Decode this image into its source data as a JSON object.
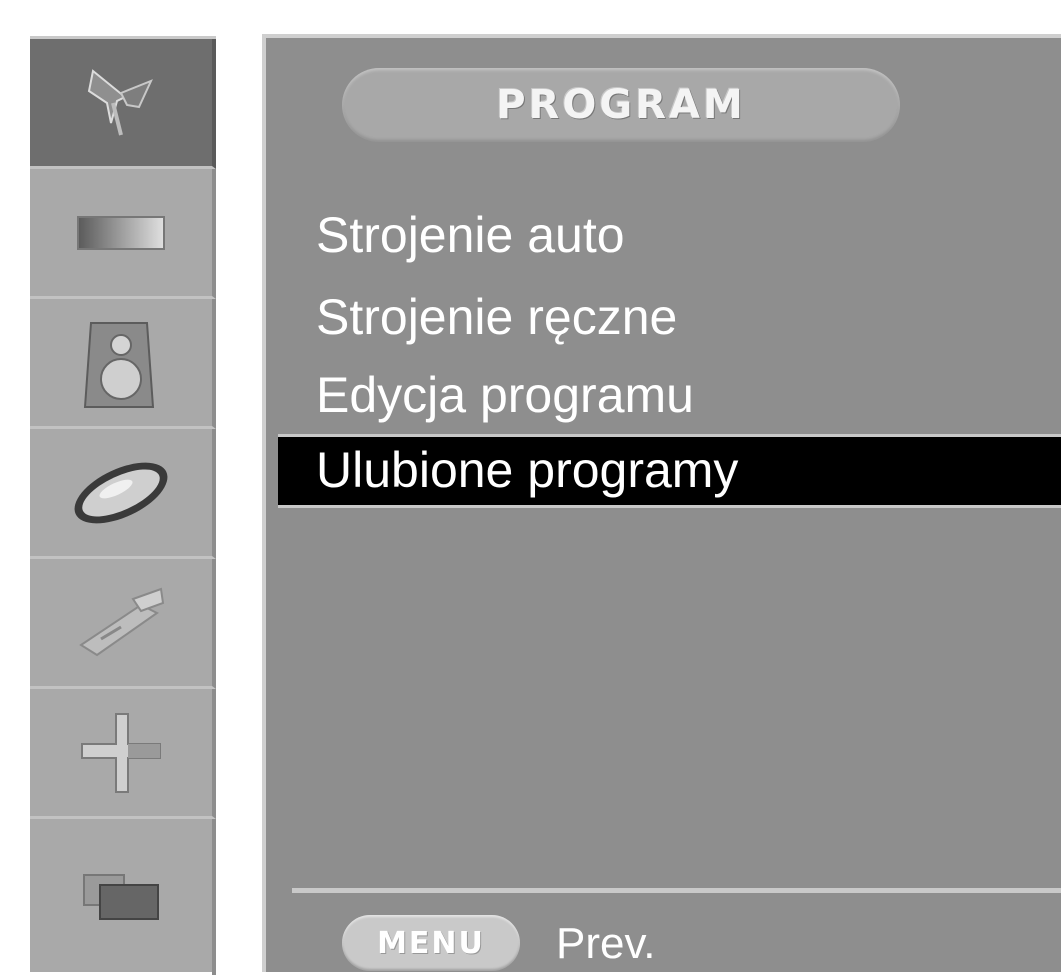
{
  "sidebar": {
    "items": [
      {
        "icon": "antenna-icon",
        "selected": true
      },
      {
        "icon": "picture-icon",
        "selected": false
      },
      {
        "icon": "speaker-icon",
        "selected": false
      },
      {
        "icon": "clock-icon",
        "selected": false
      },
      {
        "icon": "lock-icon",
        "selected": false
      },
      {
        "icon": "special-icon",
        "selected": false
      },
      {
        "icon": "screen-icon",
        "selected": false
      }
    ]
  },
  "menu": {
    "title": "PROGRAM",
    "items": [
      {
        "label": "Strojenie  auto",
        "selected": false
      },
      {
        "label": "Strojenie ręczne",
        "selected": false
      },
      {
        "label": "Edycja programu",
        "selected": false
      },
      {
        "label": "Ulubione programy",
        "selected": true
      }
    ]
  },
  "footer": {
    "key_label": "MENU",
    "action_label": "Prev."
  },
  "colors": {
    "panel": "#8e8e8e",
    "sidebar": "#a9a9a9",
    "selected_bg": "#000000",
    "text": "#ffffff"
  }
}
